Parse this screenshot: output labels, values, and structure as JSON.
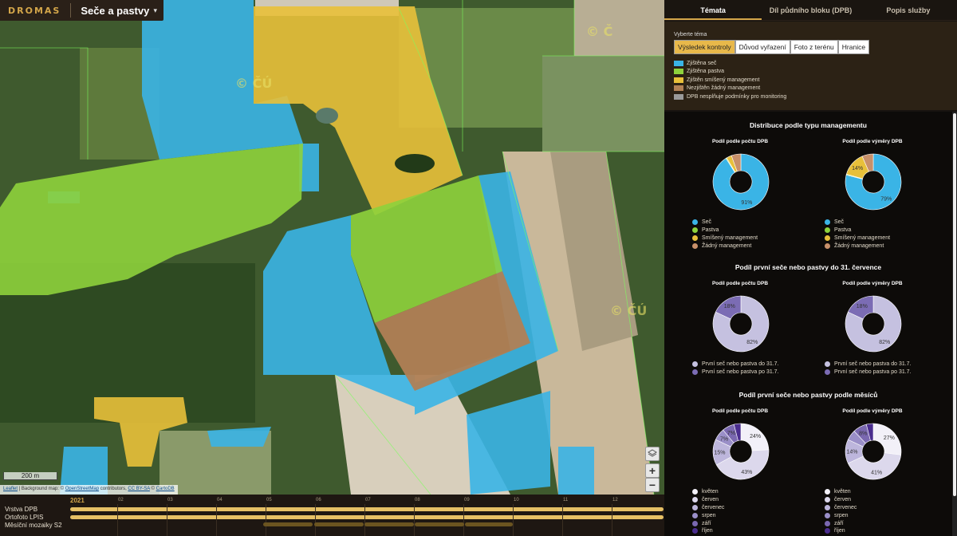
{
  "brand": {
    "logo": "DROMAS",
    "app_title": "Seče a pastvy",
    "caret": "▾"
  },
  "map": {
    "scale_label": "200 m",
    "attribution": {
      "leaflet": "Leaflet",
      "text1": " | Background map: © ",
      "osm": "OpenStreetMap",
      "text2": " contributors, ",
      "cc": "CC BY-SA",
      "text3": " © ",
      "carto": "CartoDB"
    },
    "zoom_in": "+",
    "zoom_out": "−",
    "layers_icon": "layers-icon"
  },
  "timeline": {
    "year": "2021",
    "months": [
      "02",
      "03",
      "04",
      "05",
      "06",
      "07",
      "08",
      "09",
      "10",
      "11",
      "12"
    ],
    "layers": [
      "Vrstva DPB",
      "Ortofoto LPIS",
      "Měsíční mozaiky S2"
    ]
  },
  "panel": {
    "tabs": [
      "Témata",
      "Díl půdního bloku (DPB)",
      "Popis služby"
    ],
    "active_tab": 0,
    "theme_title": "Vyberte téma",
    "theme_buttons": [
      "Výsledek kontroly",
      "Důvod vyřazení",
      "Foto z terénu",
      "Hranice"
    ],
    "active_theme": 0,
    "legend": [
      {
        "label": "Zjištěna seč",
        "color": "#3ab4e6"
      },
      {
        "label": "Zjištěna pastva",
        "color": "#8ed23c"
      },
      {
        "label": "Zjištěn smíšený management",
        "color": "#e8c03a"
      },
      {
        "label": "Nezjištěn žádný management",
        "color": "#b08055"
      },
      {
        "label": "DPB nesplňuje podmínky pro monitoring",
        "color": "#9a9a9a"
      }
    ]
  },
  "chart_data": [
    {
      "type": "pie",
      "section_title": "Distribuce podle typu managementu",
      "title": "Podíl podle počtu DPB",
      "categories": [
        "Seč",
        "Pastva",
        "Smíšený management",
        "Žádný management"
      ],
      "values": [
        91,
        0.5,
        3,
        5.5
      ],
      "labels": [
        "91%",
        "",
        "",
        ""
      ],
      "colors": [
        "#3ab4e6",
        "#8ed23c",
        "#e8c03a",
        "#c8906a"
      ]
    },
    {
      "type": "pie",
      "title": "Podíl podle výměry DPB",
      "categories": [
        "Seč",
        "Pastva",
        "Smíšený management",
        "Žádný management"
      ],
      "values": [
        79,
        0.5,
        14,
        6.5
      ],
      "labels": [
        "79%",
        "",
        "14%",
        ""
      ],
      "colors": [
        "#3ab4e6",
        "#8ed23c",
        "#e8c03a",
        "#c8906a"
      ]
    },
    {
      "type": "pie",
      "section_title": "Podíl první seče nebo pastvy do 31. července",
      "title": "Podíl podle počtu DPB",
      "categories": [
        "První seč nebo pastva do 31.7.",
        "První seč nebo pastva po 31.7."
      ],
      "values": [
        82,
        18
      ],
      "labels": [
        "82%",
        "18%"
      ],
      "colors": [
        "#c5c1e0",
        "#7b6cb4"
      ]
    },
    {
      "type": "pie",
      "title": "Podíl podle výměry DPB",
      "categories": [
        "První seč nebo pastva do 31.7.",
        "První seč nebo pastva po 31.7."
      ],
      "values": [
        82,
        18
      ],
      "labels": [
        "82%",
        "18%"
      ],
      "colors": [
        "#c5c1e0",
        "#7b6cb4"
      ]
    },
    {
      "type": "pie",
      "section_title": "Podíl první seče nebo pastvy podle měsíců",
      "title": "Podíl podle počtu DPB",
      "categories": [
        "květen",
        "červen",
        "červenec",
        "srpen",
        "září",
        "říjen"
      ],
      "values": [
        24,
        43,
        15,
        7,
        7,
        4
      ],
      "labels": [
        "24%",
        "43%",
        "15%",
        "7%",
        "7%",
        ""
      ],
      "colors": [
        "#f2f0f8",
        "#dcd8ec",
        "#bdb6dc",
        "#9a8fc8",
        "#7a68b0",
        "#4a2d8e"
      ]
    },
    {
      "type": "pie",
      "title": "Podíl podle výměry DPB",
      "categories": [
        "květen",
        "červen",
        "červenec",
        "srpen",
        "září",
        "říjen"
      ],
      "values": [
        27,
        41,
        14,
        6,
        8,
        4
      ],
      "labels": [
        "27%",
        "41%",
        "14%",
        "",
        "8%",
        ""
      ],
      "colors": [
        "#f2f0f8",
        "#dcd8ec",
        "#bdb6dc",
        "#9a8fc8",
        "#7a68b0",
        "#4a2d8e"
      ]
    }
  ]
}
